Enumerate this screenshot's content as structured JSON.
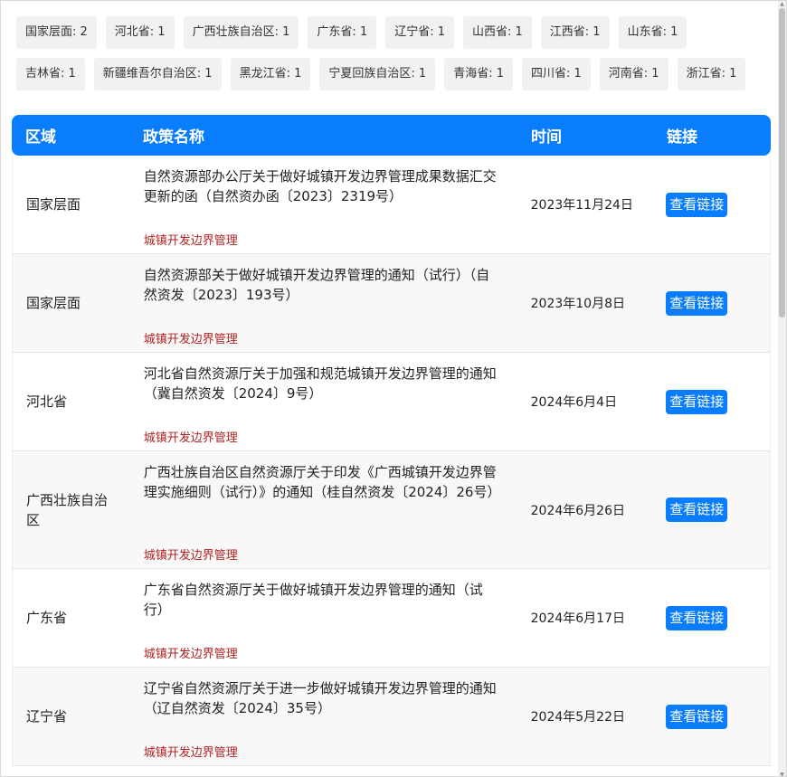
{
  "filters": [
    {
      "label": "国家层面: 2"
    },
    {
      "label": "河北省: 1"
    },
    {
      "label": "广西壮族自治区: 1"
    },
    {
      "label": "广东省: 1"
    },
    {
      "label": "辽宁省: 1"
    },
    {
      "label": "山西省: 1"
    },
    {
      "label": "江西省: 1"
    },
    {
      "label": "山东省: 1"
    },
    {
      "label": "吉林省: 1"
    },
    {
      "label": "新疆维吾尔自治区: 1"
    },
    {
      "label": "黑龙江省: 1"
    },
    {
      "label": "宁夏回族自治区: 1"
    },
    {
      "label": "青海省: 1"
    },
    {
      "label": "四川省: 1"
    },
    {
      "label": "河南省: 1"
    },
    {
      "label": "浙江省: 1"
    }
  ],
  "table": {
    "headers": {
      "region": "区域",
      "policy": "政策名称",
      "date": "时间",
      "link": "链接"
    },
    "rows": [
      {
        "region": "国家层面",
        "title": "自然资源部办公厅关于做好城镇开发边界管理成果数据汇交更新的函（自然资办函〔2023〕2319号）",
        "tag": "城镇开发边界管理",
        "date": "2023年11月24日",
        "link": "查看链接"
      },
      {
        "region": "国家层面",
        "title": "自然资源部关于做好城镇开发边界管理的通知（试行）（自然资发〔2023〕193号）",
        "tag": "城镇开发边界管理",
        "date": "2023年10月8日",
        "link": "查看链接"
      },
      {
        "region": "河北省",
        "title": "河北省自然资源厅关于加强和规范城镇开发边界管理的通知（冀自然资发〔2024〕9号）",
        "tag": "城镇开发边界管理",
        "date": "2024年6月4日",
        "link": "查看链接"
      },
      {
        "region": "广西壮族自治区",
        "title": "广西壮族自治区自然资源厅关于印发《广西城镇开发边界管理实施细则（试行）》的通知（桂自然资发〔2024〕26号）",
        "tag": "城镇开发边界管理",
        "date": "2024年6月26日",
        "link": "查看链接"
      },
      {
        "region": "广东省",
        "title": "广东省自然资源厅关于做好城镇开发边界管理的通知（试行）",
        "tag": "城镇开发边界管理",
        "date": "2024年6月17日",
        "link": "查看链接"
      },
      {
        "region": "辽宁省",
        "title": "辽宁省自然资源厅关于进一步做好城镇开发边界管理的通知（辽自然资发〔2024〕35号）",
        "tag": "城镇开发边界管理",
        "date": "2024年5月22日",
        "link": "查看链接"
      }
    ]
  }
}
